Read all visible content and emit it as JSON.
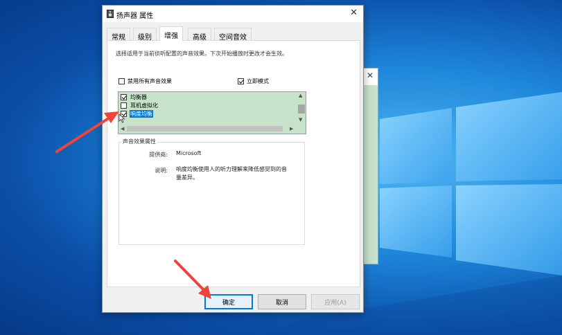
{
  "dialog": {
    "title": "扬声器 属性",
    "close_glyph": "✕",
    "tabs": [
      {
        "label": "常规",
        "active": false
      },
      {
        "label": "级别",
        "active": false
      },
      {
        "label": "增强",
        "active": true
      },
      {
        "label": "高级",
        "active": false
      },
      {
        "label": "空间音效",
        "active": false
      }
    ],
    "description": "选择适用于当前侦听配置的声音效果。下次开始播放时更改才会生效。",
    "disable_all_label": "禁用所有声音效果",
    "disable_all_checked": false,
    "immediate_mode_label": "立即模式",
    "immediate_mode_checked": true,
    "effects": [
      {
        "label": "均衡器",
        "checked": true,
        "selected": false
      },
      {
        "label": "耳机虚拟化",
        "checked": false,
        "selected": false
      },
      {
        "label": "响度均衡",
        "checked": true,
        "selected": true
      }
    ],
    "properties": {
      "group_title": "声音效果属性",
      "provider_label": "提供商:",
      "provider_value": "Microsoft",
      "description_label": "说明:",
      "description_line1": "响度均衡使用人的听力理解来降低感觉到的音",
      "description_line2": "量差异。"
    },
    "buttons": {
      "ok": "确定",
      "cancel": "取消",
      "apply": "应用(A)"
    }
  },
  "background_window": {
    "close_glyph": "✕"
  },
  "colors": {
    "accent": "#0078d7",
    "list_background": "#c6e2c9",
    "annotation_arrow": "#f0443a",
    "desktop_blue": "#1d86d9"
  }
}
